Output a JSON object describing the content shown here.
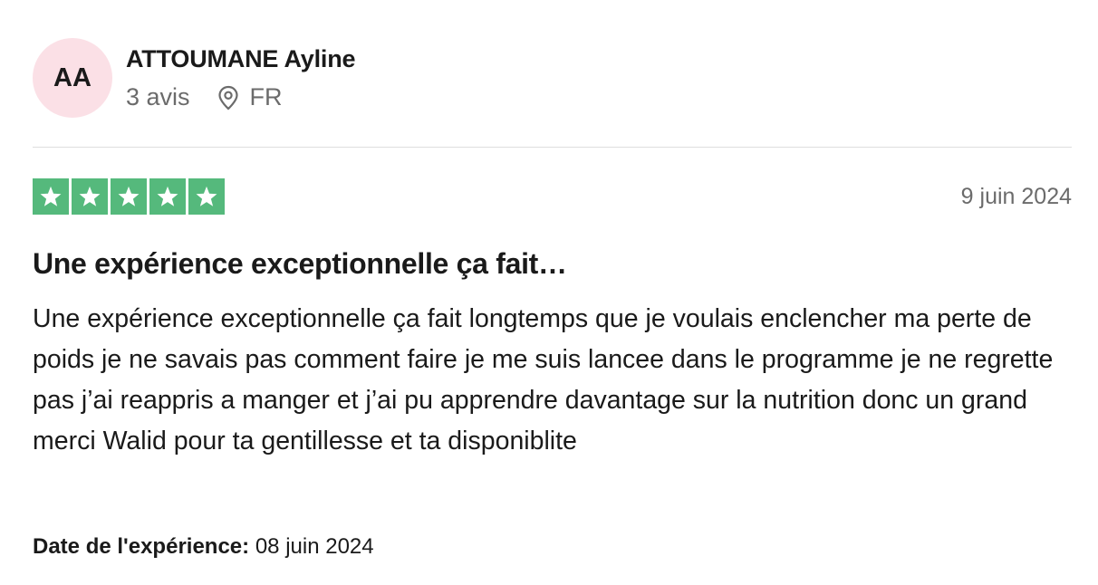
{
  "reviewer": {
    "initials": "AA",
    "name": "ATTOUMANE Ayline",
    "review_count": "3 avis",
    "country": "FR",
    "avatar_bg": "#fbe0e6"
  },
  "review": {
    "rating": 5,
    "rating_max": 5,
    "star_color": "#55b97c",
    "date": "9 juin 2024",
    "title": "Une expérience exceptionnelle ça fait…",
    "text": "Une expérience exceptionnelle ça fait longtemps que je voulais enclencher ma perte de poids je ne savais pas comment faire je me suis lancee dans le programme je ne regrette pas j’ai reappris a manger et j’ai pu apprendre davantage sur la nutrition donc un grand merci Walid pour ta gentillesse et ta disponiblite",
    "experience_label": "Date de l'expérience:",
    "experience_date": "08 juin 2024"
  },
  "icons": {
    "location": "location-pin-icon",
    "star": "star-icon"
  }
}
